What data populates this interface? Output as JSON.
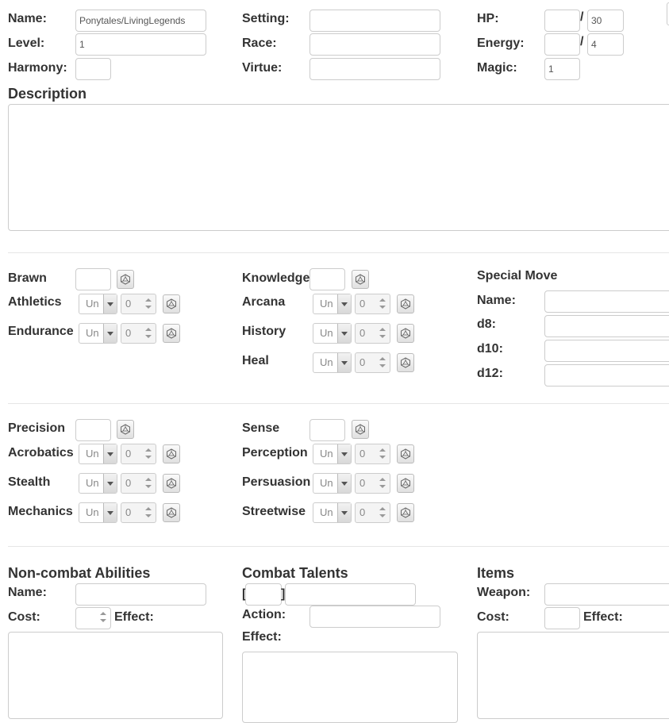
{
  "header": {
    "name_label": "Name:",
    "name_value": "Ponytales/LivingLegends",
    "level_label": "Level:",
    "level_value": "1",
    "harmony_label": "Harmony:",
    "harmony_value": "",
    "setting_label": "Setting:",
    "setting_value": "",
    "race_label": "Race:",
    "race_value": "",
    "virtue_label": "Virtue:",
    "virtue_value": "",
    "hp_label": "HP:",
    "hp_current": "",
    "hp_max": "30",
    "energy_label": "Energy:",
    "energy_current": "",
    "energy_max": "4",
    "magic_label": "Magic:",
    "magic_value": "1",
    "slash": "/"
  },
  "description": {
    "title": "Description",
    "value": ""
  },
  "attributes": {
    "brawn": {
      "label": "Brawn",
      "skills": [
        {
          "label": "Athletics",
          "rank": "Un",
          "bonus": "0"
        },
        {
          "label": "Endurance",
          "rank": "Un",
          "bonus": "0"
        }
      ]
    },
    "knowledge": {
      "label": "Knowledge",
      "skills": [
        {
          "label": "Arcana",
          "rank": "Un",
          "bonus": "0"
        },
        {
          "label": "History",
          "rank": "Un",
          "bonus": "0"
        },
        {
          "label": "Heal",
          "rank": "Un",
          "bonus": "0"
        }
      ]
    },
    "precision": {
      "label": "Precision",
      "skills": [
        {
          "label": "Acrobatics",
          "rank": "Un",
          "bonus": "0"
        },
        {
          "label": "Stealth",
          "rank": "Un",
          "bonus": "0"
        },
        {
          "label": "Mechanics",
          "rank": "Un",
          "bonus": "0"
        }
      ]
    },
    "sense": {
      "label": "Sense",
      "skills": [
        {
          "label": "Perception",
          "rank": "Un",
          "bonus": "0"
        },
        {
          "label": "Persuasion",
          "rank": "Un",
          "bonus": "0"
        },
        {
          "label": "Streetwise",
          "rank": "Un",
          "bonus": "0"
        }
      ]
    }
  },
  "special_move": {
    "title": "Special Move",
    "name_label": "Name:",
    "d8_label": "d8:",
    "d10_label": "d10:",
    "d12_label": "d12:"
  },
  "noncombat": {
    "title": "Non-combat Abilities",
    "name_label": "Name:",
    "cost_label": "Cost:",
    "effect_label": "Effect:"
  },
  "combat": {
    "title": "Combat Talents",
    "bracket_open": "[",
    "bracket_close": "]",
    "action_label": "Action:",
    "effect_label": "Effect:"
  },
  "items": {
    "title": "Items",
    "weapon_label": "Weapon:",
    "cost_label": "Cost:",
    "effect_label": "Effect:"
  },
  "icons": {
    "dice": "d20-dice-icon"
  },
  "colors": {
    "border": "#cccccc",
    "text": "#333333",
    "divider": "#e6e6e6"
  }
}
